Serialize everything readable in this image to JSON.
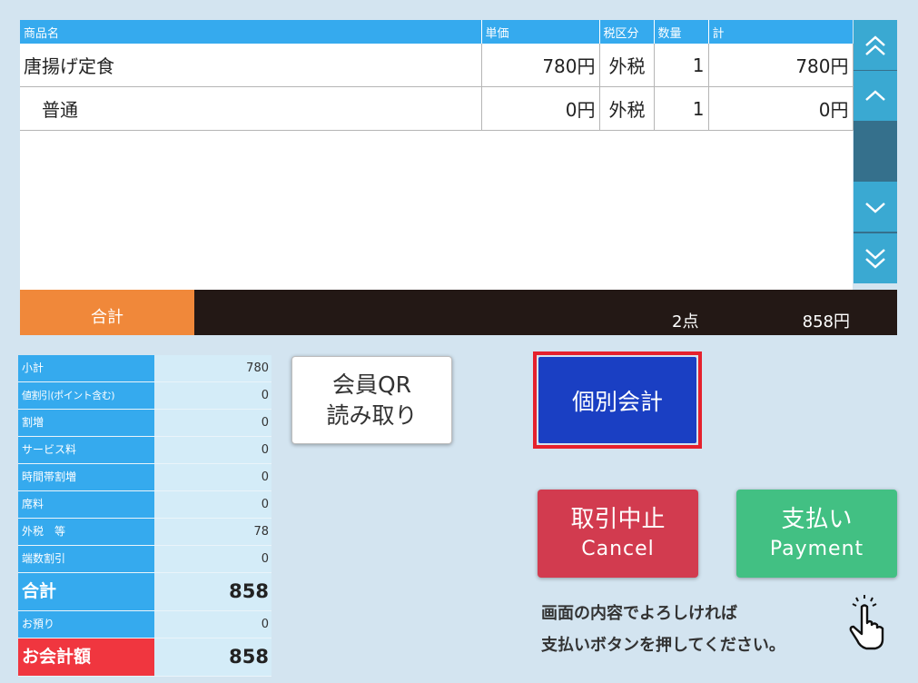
{
  "table": {
    "headers": [
      "商品名",
      "単価",
      "税区分",
      "数量",
      "計"
    ],
    "rows": [
      {
        "name": "唐揚げ定食",
        "price": "780円",
        "tax": "外税",
        "qty": "1",
        "total": "780円"
      },
      {
        "name": "普通",
        "price": "0円",
        "tax": "外税",
        "qty": "1",
        "total": "0円"
      }
    ]
  },
  "scroll": {
    "top_icon": "double-chevron-up-icon",
    "up_icon": "chevron-up-icon",
    "down_icon": "chevron-down-icon",
    "bottom_icon": "double-chevron-down-icon"
  },
  "total_bar": {
    "label": "合計",
    "count": "2点",
    "amount": "858円"
  },
  "summary": [
    {
      "key": "小計",
      "value": "780"
    },
    {
      "key": "値割引(ポイント含む)",
      "value": "0"
    },
    {
      "key": "割増",
      "value": "0"
    },
    {
      "key": "サービス料",
      "value": "0"
    },
    {
      "key": "時間帯割増",
      "value": "0"
    },
    {
      "key": "席料",
      "value": "0"
    },
    {
      "key": "外税　等",
      "value": "78"
    },
    {
      "key": "端数割引",
      "value": "0"
    },
    {
      "key": "合計",
      "value": "858"
    },
    {
      "key": "お預り",
      "value": "0"
    },
    {
      "key": "お会計額",
      "value": "858"
    }
  ],
  "buttons": {
    "qr_line1": "会員QR",
    "qr_line2": "読み取り",
    "individual": "個別会計",
    "cancel_jp": "取引中止",
    "cancel_en": "Cancel",
    "pay_jp": "支払い",
    "pay_en": "Payment"
  },
  "message": {
    "line1": "画面の内容でよろしければ",
    "line2": "支払いボタンを押してください。"
  },
  "colors": {
    "header": "#35aaee",
    "total_label": "#f0883a",
    "total_bar": "#231815",
    "individual": "#1a3fc3",
    "highlight_frame": "#e5212d",
    "cancel": "#d23b4f",
    "pay": "#42c083",
    "amount_due": "#f0363f"
  },
  "icons": {
    "pointer": "tap-hand-icon"
  }
}
